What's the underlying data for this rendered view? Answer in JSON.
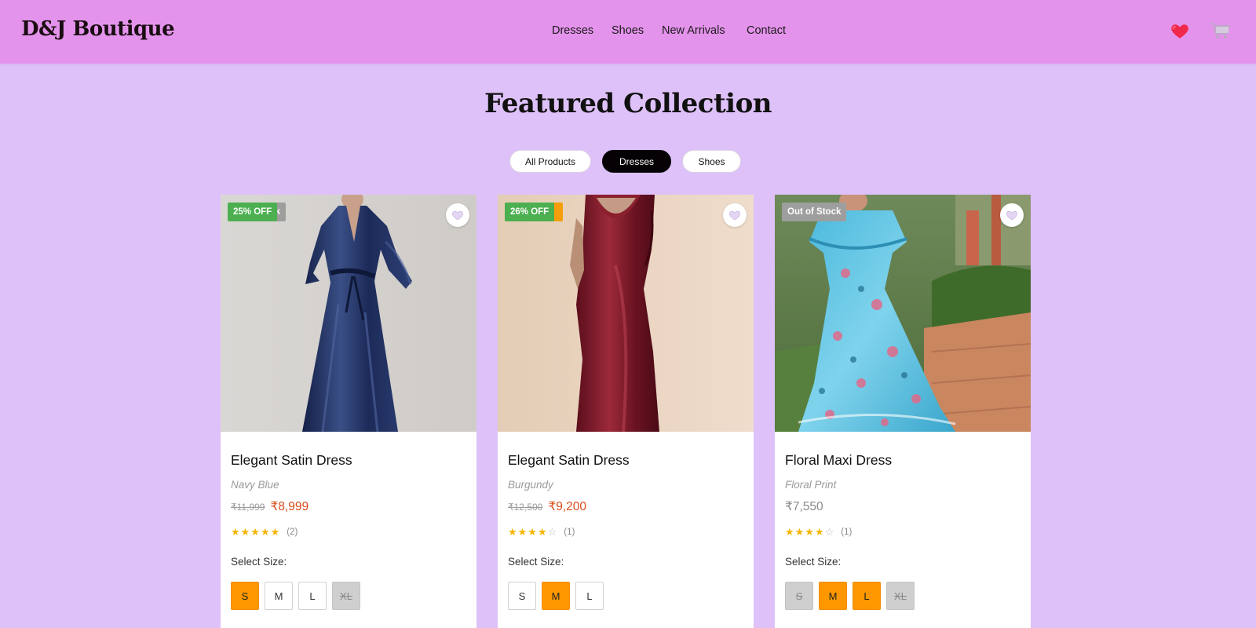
{
  "header": {
    "logo": "D&J Boutique",
    "nav": [
      "Dresses",
      "Shoes",
      "New Arrivals",
      "Contact"
    ],
    "icons": [
      "heart-icon",
      "cart-icon"
    ],
    "bg_color": "#e493ec"
  },
  "main": {
    "title": "Featured Collection",
    "filters": [
      {
        "label": "All Products",
        "active": false
      },
      {
        "label": "Dresses",
        "active": true
      },
      {
        "label": "Shoes",
        "active": false
      }
    ],
    "bg_color": "#dec1f8"
  },
  "products": [
    {
      "badges": [
        "ck",
        "25% OFF"
      ],
      "name": "Elegant Satin Dress",
      "variant": "Navy Blue",
      "old_price": "₹11,999",
      "price": "₹8,999",
      "rating": 5,
      "reviews": "(2)",
      "size_label": "Select Size:",
      "sizes": [
        {
          "label": "S",
          "state": "selected"
        },
        {
          "label": "M",
          "state": "available"
        },
        {
          "label": "L",
          "state": "available"
        },
        {
          "label": "XL",
          "state": "unavailable"
        }
      ]
    },
    {
      "badges": [
        "26% OFF"
      ],
      "name": "Elegant Satin Dress",
      "variant": "Burgundy",
      "old_price": "₹12,500",
      "price": "₹9,200",
      "rating": 4,
      "reviews": "(1)",
      "size_label": "Select Size:",
      "sizes": [
        {
          "label": "S",
          "state": "available"
        },
        {
          "label": "M",
          "state": "selected"
        },
        {
          "label": "L",
          "state": "available"
        }
      ]
    },
    {
      "badges": [
        "Out of Stock"
      ],
      "name": "Floral Maxi Dress",
      "variant": "Floral Print",
      "old_price": "",
      "price": "₹7,550",
      "rating": 4,
      "reviews": "(1)",
      "size_label": "Select Size:",
      "sizes": [
        {
          "label": "S",
          "state": "unavailable"
        },
        {
          "label": "M",
          "state": "selected"
        },
        {
          "label": "L",
          "state": "selected"
        },
        {
          "label": "XL",
          "state": "unavailable"
        }
      ]
    }
  ],
  "colors": {
    "accent_orange": "#ff9800",
    "sale_red": "#d84a1b",
    "discount_green": "#4caf50",
    "star_yellow": "#f5b400"
  }
}
